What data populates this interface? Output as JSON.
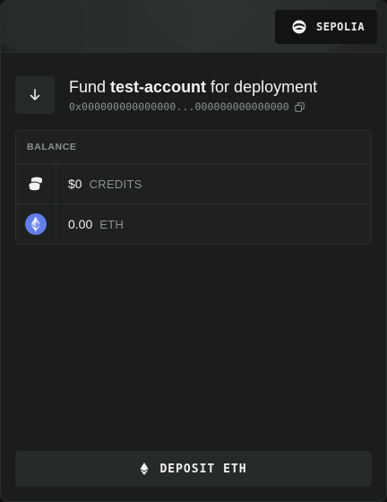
{
  "header": {
    "network_label": "SEPOLIA",
    "network_icon": "network-globe-icon"
  },
  "fund": {
    "prefix": "Fund ",
    "account_name": "test-account",
    "suffix": " for deployment",
    "address": "0x000000000000000...000000000000000",
    "direction_icon": "arrow-down-icon",
    "copy_icon": "copy-icon"
  },
  "balance": {
    "header": "BALANCE",
    "rows": [
      {
        "icon": "coins-icon",
        "amount": "$0",
        "unit": "CREDITS"
      },
      {
        "icon": "ethereum-icon",
        "amount": "0.00",
        "unit": "ETH"
      }
    ]
  },
  "deposit": {
    "label": "DEPOSIT ETH",
    "icon": "ethereum-icon"
  },
  "colors": {
    "background": "#1a1d1b",
    "surface": "#1e211f",
    "border": "#2a2f2b",
    "muted_text": "#8d938f",
    "eth_badge": "#627eea"
  }
}
